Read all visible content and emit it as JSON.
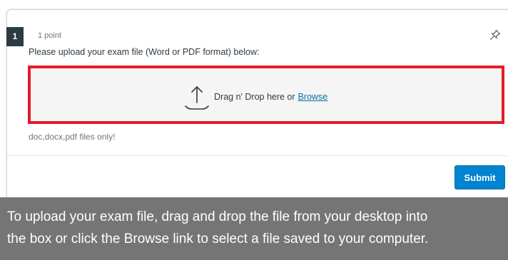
{
  "question": {
    "number": "1",
    "points": "1 point",
    "prompt": "Please upload your exam file (Word or PDF format) below:",
    "icons": {
      "pin": "pin-icon",
      "upload": "upload-icon"
    }
  },
  "dropzone": {
    "text": "Drag n' Drop here or",
    "browse_label": "Browse",
    "highlight_color": "#e41b2a"
  },
  "hint": "doc,docx,pdf files only!",
  "actions": {
    "submit_label": "Submit",
    "submit_color": "#0084d1"
  },
  "caption": {
    "line1": "To upload your exam file, drag and drop the file from your desktop into",
    "line2": "the box or click the Browse link to select a file saved to your computer."
  }
}
